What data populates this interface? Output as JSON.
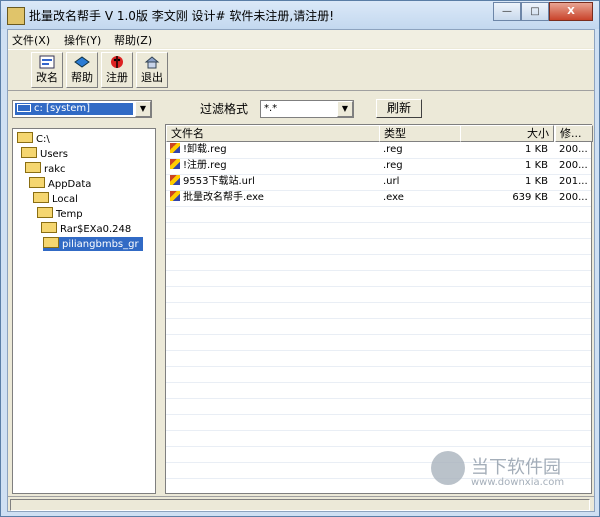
{
  "window": {
    "title": "批量改名帮手  V 1.0版  李文刚 设计# 软件未注册,请注册!",
    "min_label": "—",
    "max_label": "□",
    "close_label": "X"
  },
  "menu": [
    {
      "label": "文件(X)"
    },
    {
      "label": "操作(Y)"
    },
    {
      "label": "帮助(Z)"
    }
  ],
  "toolbar": [
    {
      "label": "改名",
      "icon": "rename-icon"
    },
    {
      "label": "帮助",
      "icon": "help-icon"
    },
    {
      "label": "注册",
      "icon": "register-icon"
    },
    {
      "label": "退出",
      "icon": "exit-icon"
    }
  ],
  "drive": {
    "value": "c: [system]"
  },
  "filter": {
    "label": "过滤格式",
    "value": "*.*",
    "refresh": "刷新"
  },
  "tree": [
    {
      "label": "C:\\",
      "depth": 0
    },
    {
      "label": "Users",
      "depth": 1
    },
    {
      "label": "rakc",
      "depth": 2
    },
    {
      "label": "AppData",
      "depth": 3
    },
    {
      "label": "Local",
      "depth": 4
    },
    {
      "label": "Temp",
      "depth": 5
    },
    {
      "label": "Rar$EXa0.248",
      "depth": 6
    },
    {
      "label": "piliangbmbs_gr",
      "depth": 7,
      "selected": true
    }
  ],
  "list": {
    "columns": [
      "文件名",
      "类型",
      "大小",
      "修..."
    ],
    "rows": [
      {
        "name": "!卸载.reg",
        "type": ".reg",
        "size": "1 KB",
        "modified": "200..."
      },
      {
        "name": "!注册.reg",
        "type": ".reg",
        "size": "1 KB",
        "modified": "200..."
      },
      {
        "name": "9553下载站.url",
        "type": ".url",
        "size": "1 KB",
        "modified": "201..."
      },
      {
        "name": "批量改名帮手.exe",
        "type": ".exe",
        "size": "639 KB",
        "modified": "200..."
      }
    ]
  },
  "watermark": {
    "text": "当下软件园",
    "url": "www.downxia.com"
  },
  "colors": {
    "selection": "#316ac5",
    "chrome": "#ece9d8",
    "frame": "#cfe0f3"
  }
}
